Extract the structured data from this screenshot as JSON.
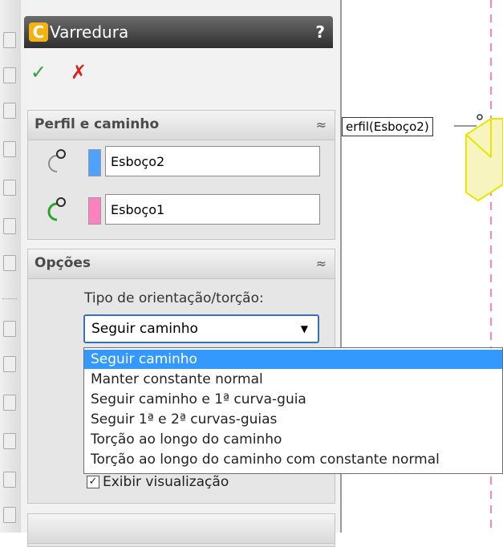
{
  "window": {
    "title": "Varredura",
    "help": "?"
  },
  "actions": {
    "ok": "✓",
    "cancel": "✗"
  },
  "profile_path": {
    "header": "Perfil e caminho",
    "profile_value": "Esboço2",
    "path_value": "Esboço1",
    "colors": {
      "profile": "#4da3ff",
      "path": "#ff80c0"
    }
  },
  "options": {
    "header": "Opções",
    "orientation_label": "Tipo de orientação/torção:",
    "orientation_value": "Seguir caminho",
    "orientation_options": [
      "Seguir caminho",
      "Manter constante normal",
      "Seguir caminho e 1ª curva-guia",
      "Seguir 1ª e 2ª curvas-guias",
      "Torção ao longo do caminho",
      "Torção ao longo do caminho com constante normal"
    ],
    "preview_label": "Exibir visualização",
    "preview_checked": true
  },
  "graphics": {
    "callout": "erfil(Esboço2)"
  },
  "colors": {
    "accent": "#3399ff",
    "title_bar": "#3a3a3a",
    "shape_edge": "#e6e600"
  }
}
